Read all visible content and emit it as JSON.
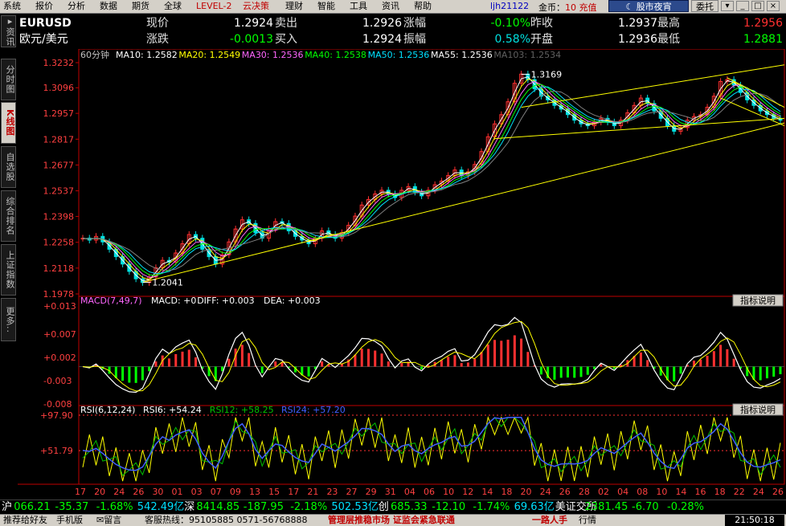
{
  "menu": [
    "系统",
    "报价",
    "分析",
    "数据",
    "期货",
    "全球",
    "LEVEL-2",
    "云决策",
    "理财",
    "智能",
    "工具",
    "资讯",
    "帮助"
  ],
  "account": "ljh21122",
  "coin_label": "金币：",
  "coin_value": "10",
  "coin_action": "充值",
  "night_btn": "股市夜宵",
  "trust_btn": "委托",
  "side_tabs": [
    "资讯",
    "分时图",
    "K线图",
    "自选股",
    "综合排名",
    "上证指数",
    "更多.."
  ],
  "quote": {
    "code": "EURUSD",
    "name": "欧元/美元",
    "now_label": "现价",
    "now": "1.2924",
    "sell_label": "卖出",
    "sell": "1.2926",
    "pct_label": "涨幅",
    "pct": "-0.10%",
    "prev_label": "昨收",
    "prev": "1.2937",
    "high_label": "最高",
    "high": "1.2956",
    "chg_label": "涨跌",
    "chg": "-0.0013",
    "buy_label": "买入",
    "buy": "1.2924",
    "amp_label": "振幅",
    "amp": "0.58%",
    "open_label": "开盘",
    "open": "1.2936",
    "low_label": "最低",
    "low": "1.2881"
  },
  "ma_legend": {
    "period": "60分钟",
    "items": [
      {
        "text": "MA10: 1.2582",
        "color": "#ffffff"
      },
      {
        "text": "MA20: 1.2549",
        "color": "#ffff00"
      },
      {
        "text": "MA30: 1.2536",
        "color": "#ff66ff"
      },
      {
        "text": "MA40: 1.2538",
        "color": "#00ff00"
      },
      {
        "text": "MA50: 1.2536",
        "color": "#00e0ff"
      },
      {
        "text": "MA55: 1.2536",
        "color": "#ffffff"
      },
      {
        "text": "MA103: 1.2534",
        "color": "#606060"
      }
    ]
  },
  "chart_data": [
    {
      "type": "line",
      "panel": "price",
      "y_ticks": [
        "1.3232",
        "1.3096",
        "1.2957",
        "1.2817",
        "1.2677",
        "1.2537",
        "1.2398",
        "1.2258",
        "1.2118",
        "1.1978"
      ],
      "ylim": [
        1.1978,
        1.3232
      ],
      "annotations": [
        {
          "text": "1.3169",
          "value": 1.3169
        },
        {
          "text": "1.2041",
          "value": 1.2041
        }
      ],
      "series_close": [
        1.228,
        1.227,
        1.229,
        1.226,
        1.222,
        1.218,
        1.214,
        1.21,
        1.206,
        1.204,
        1.207,
        1.212,
        1.216,
        1.215,
        1.22,
        1.225,
        1.23,
        1.228,
        1.222,
        1.218,
        1.214,
        1.219,
        1.226,
        1.233,
        1.238,
        1.236,
        1.231,
        1.228,
        1.233,
        1.237,
        1.236,
        1.232,
        1.229,
        1.227,
        1.225,
        1.228,
        1.232,
        1.23,
        1.228,
        1.231,
        1.235,
        1.24,
        1.246,
        1.249,
        1.252,
        1.254,
        1.252,
        1.25,
        1.254,
        1.256,
        1.253,
        1.251,
        1.254,
        1.257,
        1.259,
        1.262,
        1.265,
        1.262,
        1.264,
        1.268,
        1.275,
        1.283,
        1.29,
        1.295,
        1.302,
        1.312,
        1.317,
        1.314,
        1.309,
        1.305,
        1.303,
        1.3,
        1.298,
        1.295,
        1.292,
        1.29,
        1.289,
        1.291,
        1.293,
        1.291,
        1.289,
        1.292,
        1.296,
        1.3,
        1.304,
        1.301,
        1.297,
        1.293,
        1.289,
        1.286,
        1.288,
        1.292,
        1.294,
        1.295,
        1.299,
        1.305,
        1.313,
        1.314,
        1.311,
        1.307,
        1.303,
        1.3,
        1.297,
        1.295,
        1.293,
        1.292
      ],
      "xlabels": [
        "17",
        "20",
        "24",
        "26",
        "30",
        "01",
        "03",
        "07",
        "09",
        "13",
        "15",
        "17",
        "21",
        "23",
        "27",
        "29",
        "31",
        "04",
        "06",
        "10",
        "12",
        "14",
        "18",
        "20",
        "24",
        "26",
        "28",
        "02",
        "04",
        "08",
        "10",
        "14",
        "16",
        "18",
        "22",
        "24",
        "26"
      ]
    },
    {
      "type": "bar",
      "panel": "macd",
      "title": "MACD(7,49,7)",
      "legend": [
        {
          "text": "MACD: +0",
          "color": "#ffffff"
        },
        {
          "text": "DIFF: +0.003",
          "color": "#ffffff"
        },
        {
          "text": "DEA: +0.003",
          "color": "#ffffff"
        }
      ],
      "y_ticks": [
        "+0.013",
        "+0.007",
        "+0.002",
        "-0.003",
        "-0.008"
      ],
      "ylim": [
        -0.008,
        0.013
      ],
      "button": "指标说明"
    },
    {
      "type": "line",
      "panel": "rsi",
      "title": "RSI(6,12,24)",
      "legend": [
        {
          "text": "RSI6: +54.24",
          "color": "#ffffff"
        },
        {
          "text": "RSI12: +58.25",
          "color": "#00c000"
        },
        {
          "text": "RSI24: +57.20",
          "color": "#4060ff"
        }
      ],
      "y_ticks": [
        "+97.90",
        "+51.79"
      ],
      "ylim": [
        10,
        97.9
      ],
      "button": "指标说明"
    }
  ],
  "ticker": [
    {
      "t": "沪",
      "c": "#ffffff"
    },
    {
      "t": "066.21",
      "c": "#00ff00"
    },
    {
      "t": "-35.37",
      "c": "#00ff00"
    },
    {
      "t": "-1.68%",
      "c": "#00ff00"
    },
    {
      "t": "542.49亿",
      "c": "#00e0ff"
    },
    {
      "t": "深",
      "c": "#ffffff"
    },
    {
      "t": "8414.85",
      "c": "#00ff00"
    },
    {
      "t": "-187.95",
      "c": "#00ff00"
    },
    {
      "t": "-2.18%",
      "c": "#00ff00"
    },
    {
      "t": "502.53亿",
      "c": "#00e0ff"
    },
    {
      "t": "创",
      "c": "#ffffff"
    },
    {
      "t": "685.33",
      "c": "#00ff00"
    },
    {
      "t": "-12.10",
      "c": "#00ff00"
    },
    {
      "t": "-1.74%",
      "c": "#00ff00"
    },
    {
      "t": "69.63亿",
      "c": "#00e0ff"
    },
    {
      "t": "美证交所",
      "c": "#ffffff"
    },
    {
      "t": "2381.45",
      "c": "#00ff00"
    },
    {
      "t": "-6.70",
      "c": "#00ff00"
    },
    {
      "t": "-0.28%",
      "c": "#00ff00"
    }
  ],
  "status": {
    "s1": "推荐给好友",
    "s2": "手机版",
    "s3": "留言",
    "s4": "客服热线：95105885 0571-56768888",
    "news": "管理层推稳市场 证监会紧急联通",
    "s5": "一路人手",
    "s6": "行情",
    "clock": "21:50:18"
  }
}
